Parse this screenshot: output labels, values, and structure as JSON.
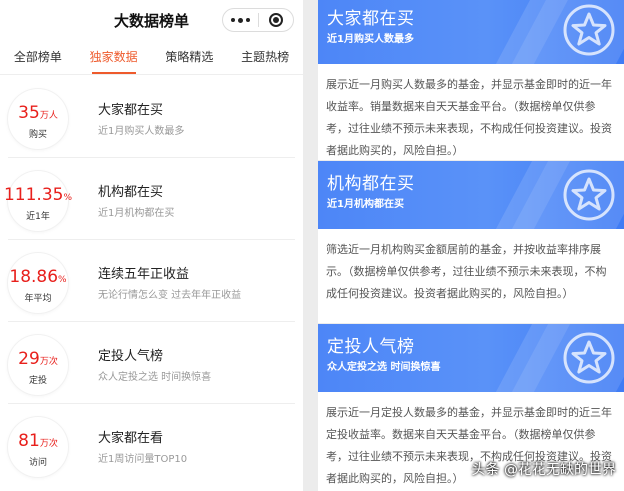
{
  "app": {
    "title": "大数据榜单"
  },
  "tabs": [
    {
      "label": "全部榜单"
    },
    {
      "label": "独家数据",
      "active": true
    },
    {
      "label": "策略精选"
    },
    {
      "label": "主题热榜"
    }
  ],
  "rankings": [
    {
      "value": "35",
      "unit": "万人",
      "caption": "购买",
      "title": "大家都在买",
      "subtitle": "近1月购买人数最多"
    },
    {
      "value": "111.35",
      "unit": "%",
      "caption": "近1年",
      "title": "机构都在买",
      "subtitle": "近1月机构都在买"
    },
    {
      "value": "18.86",
      "unit": "%",
      "caption": "年平均",
      "title": "连续五年正收益",
      "subtitle": "无论行情怎么变 过去年年正收益"
    },
    {
      "value": "29",
      "unit": "万次",
      "caption": "定投",
      "title": "定投人气榜",
      "subtitle": "众人定投之选 时间换惊喜"
    },
    {
      "value": "81",
      "unit": "万次",
      "caption": "访问",
      "title": "大家都在看",
      "subtitle": "近1周访问量TOP10"
    }
  ],
  "details": [
    {
      "title": "大家都在买",
      "subtitle": "近1月购买人数最多",
      "description": "展示近一月购买人数最多的基金，并显示基金即时的近一年收益率。销量数据来自天天基金平台。（数据榜单仅供参考，过往业绩不预示未来表现，不构成任何投资建议。投资者据此购买的，风险自担。）"
    },
    {
      "title": "机构都在买",
      "subtitle": "近1月机构都在买",
      "description": "筛选近一月机构购买金额居前的基金，并按收益率排序展示。（数据榜单仅供参考，过往业绩不预示未来表现，不构成任何投资建议。投资者据此购买的，风险自担。）"
    },
    {
      "title": "定投人气榜",
      "subtitle": "众人定投之选 时间换惊喜",
      "description": "展示近一月定投人数最多的基金，并显示基金即时的近三年定投收益率。数据来自天天基金平台。（数据榜单仅供参考，过往业绩不预示未来表现，不构成任何投资建议。投资者据此购买的，风险自担。）"
    }
  ],
  "watermark": "头条 @花花无缺的世界",
  "colors": {
    "accent": "#ee5a2c",
    "metric": "#e8201c",
    "banner": "#4d86f7"
  },
  "icons": {
    "menu": "more-dots-icon",
    "close": "target-icon",
    "badge": "star-icon"
  }
}
